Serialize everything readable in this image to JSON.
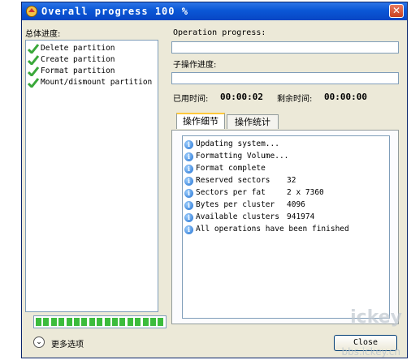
{
  "window": {
    "title": "Overall progress 100 %",
    "close_glyph": "✕"
  },
  "left": {
    "heading": "总体进度:",
    "steps": [
      {
        "label": "Delete partition",
        "icon": "check-icon"
      },
      {
        "label": "Create partition",
        "icon": "check-icon"
      },
      {
        "label": "Format partition",
        "icon": "check-icon"
      },
      {
        "label": "Mount/dismount partition",
        "icon": "check-icon"
      }
    ]
  },
  "right": {
    "operation_progress_label": "Operation progress:",
    "operation_progress_value": "",
    "sub_progress_label": "子操作进度:",
    "sub_progress_value": "",
    "elapsed_label": "已用时间:",
    "elapsed_value": "00:00:02",
    "remaining_label": "剩余时间:",
    "remaining_value": "00:00:00"
  },
  "tabs": [
    {
      "label": "操作细节",
      "active": true
    },
    {
      "label": "操作统计",
      "active": false
    }
  ],
  "log": [
    {
      "message": "Updating system...",
      "value": ""
    },
    {
      "message": "Formatting Volume...",
      "value": ""
    },
    {
      "message": "Format complete",
      "value": ""
    },
    {
      "message": "Reserved sectors",
      "value": "32"
    },
    {
      "message": "Sectors per fat",
      "value": "2 x 7360"
    },
    {
      "message": "Bytes per cluster",
      "value": "4096"
    },
    {
      "message": "Available clusters",
      "value": "941974"
    },
    {
      "message": "All operations have been finished",
      "value": ""
    }
  ],
  "overall_progress": {
    "fraction": 1.0,
    "segments": 17
  },
  "footer": {
    "more_options_glyph": "⌄",
    "more_options_label": "更多选项",
    "close_label": "Close"
  },
  "watermark": {
    "logo_text": "ickey",
    "url_text": "bbs.ickey.cn"
  },
  "colors": {
    "title_bar": "#0a57d6",
    "progress_green": "#3cbc3c",
    "check_green": "#3aa83a",
    "window_bg": "#ece9d8"
  }
}
